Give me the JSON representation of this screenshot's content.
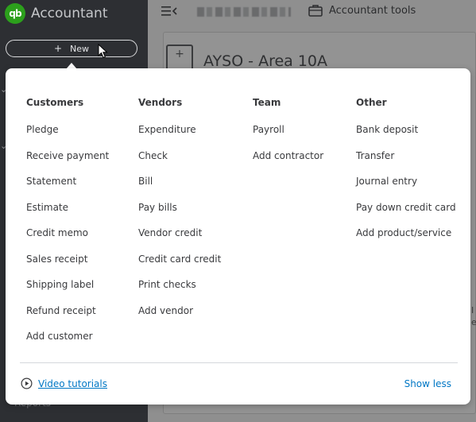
{
  "app": {
    "name": "Accountant",
    "logo_text": "qb"
  },
  "sidebar": {
    "new_button": {
      "icon": "plus-icon",
      "label": "New"
    },
    "partial_item": "Reports"
  },
  "header": {
    "menu_icon": "collapse-menu-icon",
    "accountant_tools": {
      "icon": "briefcase-icon",
      "label": "Accountant tools"
    }
  },
  "page": {
    "company_icon": "+",
    "company_name": "AYSO - Area 10A"
  },
  "new_menu": {
    "columns": [
      {
        "header": "Customers",
        "items": [
          "Pledge",
          "Receive payment",
          "Statement",
          "Estimate",
          "Credit memo",
          "Sales receipt",
          "Shipping label",
          "Refund receipt",
          "Add customer"
        ]
      },
      {
        "header": "Vendors",
        "items": [
          "Expenditure",
          "Check",
          "Bill",
          "Pay bills",
          "Vendor credit",
          "Credit card credit",
          "Print checks",
          "Add vendor"
        ]
      },
      {
        "header": "Team",
        "items": [
          "Payroll",
          "Add contractor"
        ]
      },
      {
        "header": "Other",
        "items": [
          "Bank deposit",
          "Transfer",
          "Journal entry",
          "Pay down credit card",
          "Add product/service"
        ]
      }
    ],
    "footer": {
      "video_tutorials": {
        "icon": "play-circle-icon",
        "label": "Video tutorials"
      },
      "show_less": "Show less"
    }
  },
  "colors": {
    "sidebar_bg": "#2d2f33",
    "brand_green": "#2ca01c",
    "link_blue": "#0077c5",
    "text_dark": "#393a3d",
    "overlay_bg": "#8f8f8f"
  }
}
